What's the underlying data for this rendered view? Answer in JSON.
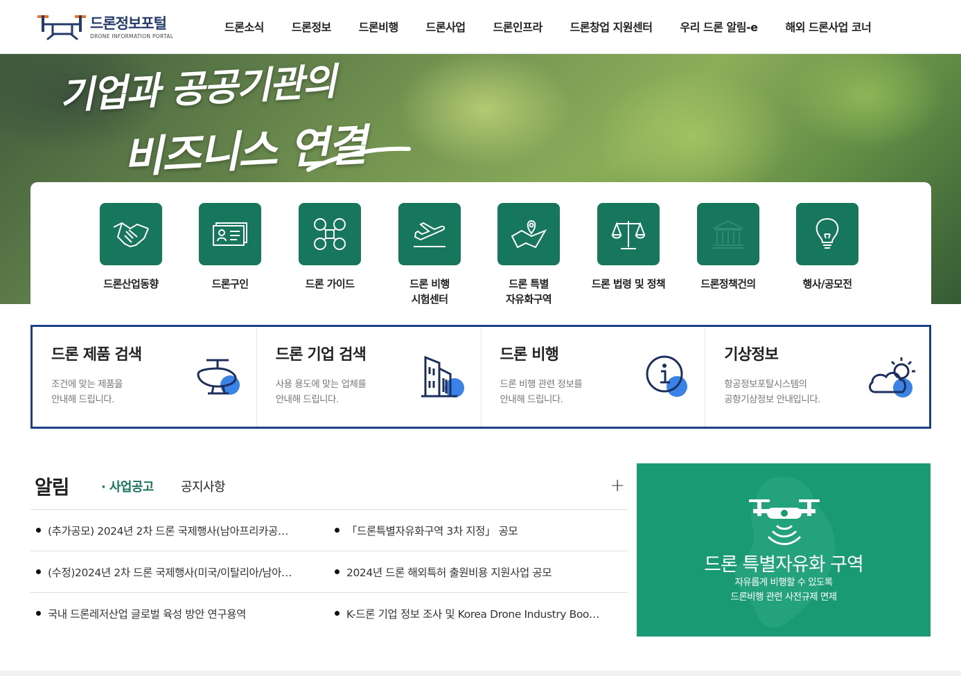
{
  "header": {
    "logo_title": "드론정보포털",
    "logo_subtitle": "DRONE INFORMATION PORTAL",
    "nav": [
      "드론소식",
      "드론정보",
      "드론비행",
      "드론사업",
      "드론인프라",
      "드론창업 지원센터",
      "우리 드론 알림-e",
      "해외 드론사업 코너"
    ]
  },
  "hero": {
    "line1": "기업과 공공기관의",
    "line2": "비즈니스 연결"
  },
  "quick_menu": [
    {
      "label": "드론산업동향",
      "icon": "handshake-icon"
    },
    {
      "label": "드론구인",
      "icon": "id-card-icon"
    },
    {
      "label": "드론 가이드",
      "icon": "drone-icon"
    },
    {
      "label": "드론 비행\n시험센터",
      "icon": "airplane-takeoff-icon"
    },
    {
      "label": "드론 특별\n자유화구역",
      "icon": "map-pin-icon"
    },
    {
      "label": "드론 법령 및 정책",
      "icon": "scales-icon"
    },
    {
      "label": "드론정책건의",
      "icon": "government-building-icon"
    },
    {
      "label": "행사/공모전",
      "icon": "lightbulb-icon"
    }
  ],
  "search_boxes": [
    {
      "title": "드론 제품 검색",
      "desc1": "조건에 맞는 제품을",
      "desc2": "안내해 드립니다.",
      "icon": "drone-product-icon"
    },
    {
      "title": "드론 기업 검색",
      "desc1": "사용 용도에 맞는 업체를",
      "desc2": "안내해 드립니다.",
      "icon": "building-icon"
    },
    {
      "title": "드론 비행",
      "desc1": "드론 비행 관련 정보를",
      "desc2": "안내해 드립니다.",
      "icon": "info-icon"
    },
    {
      "title": "기상정보",
      "desc1": "항공정보포탈시스템의",
      "desc2": "공항기상정보 안내입니다.",
      "icon": "weather-icon"
    }
  ],
  "notice": {
    "title": "알림",
    "tab_active": "· 사업공고",
    "tab_inactive": "공지사항",
    "more": "+",
    "rows": [
      [
        "(추가공모) 2024년 2차 드론 국제행사(남아프리카공…",
        "「드론특별자유화구역 3차 지정」 공모"
      ],
      [
        "(수정)2024년 2차 드론 국제행사(미국/이탈리아/남아…",
        "2024년 드론 해외특허 출원비용 지원사업 공모"
      ],
      [
        "국내 드론레저산업 글로벌 육성 방안 연구용역",
        "K-드론 기업 정보 조사 및 Korea Drone Industry Boo…"
      ]
    ]
  },
  "promo": {
    "title": "드론 특별자유화 구역",
    "desc1": "자유롭게 비행할 수 있도록",
    "desc2": "드론비행 관련 사전규제 면제"
  },
  "colors": {
    "brand_green": "#17775c",
    "brand_navy": "#1c3f85",
    "accent_blue": "#3b82e6",
    "promo_green": "#1a9a73"
  }
}
